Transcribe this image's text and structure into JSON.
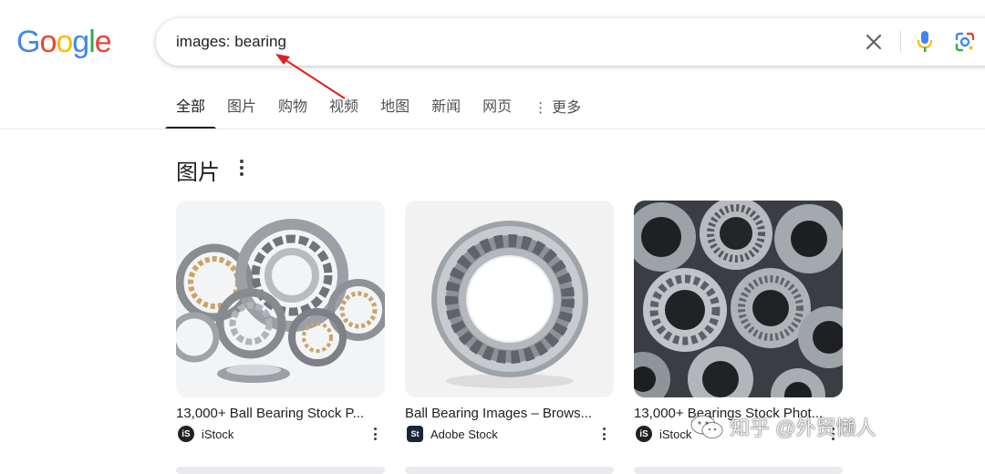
{
  "logo": {
    "letters": [
      {
        "ch": "G",
        "color": "#4285F4"
      },
      {
        "ch": "o",
        "color": "#EA4335"
      },
      {
        "ch": "o",
        "color": "#FBBC05"
      },
      {
        "ch": "g",
        "color": "#4285F4"
      },
      {
        "ch": "l",
        "color": "#34A853"
      },
      {
        "ch": "e",
        "color": "#EA4335"
      }
    ]
  },
  "search": {
    "query": "images: bearing"
  },
  "tabs": [
    {
      "label": "全部"
    },
    {
      "label": "图片"
    },
    {
      "label": "购物"
    },
    {
      "label": "视频"
    },
    {
      "label": "地图"
    },
    {
      "label": "新闻"
    },
    {
      "label": "网页"
    },
    {
      "label": "更多"
    }
  ],
  "images_section": {
    "title": "图片",
    "results": [
      {
        "caption": "13,000+ Ball Bearing Stock P...",
        "source": "iStock",
        "favicon_text": "iS"
      },
      {
        "caption": "Ball Bearing Images – Brows...",
        "source": "Adobe Stock",
        "favicon_text": "St"
      },
      {
        "caption": "13,000+ Bearings Stock Phot...",
        "source": "iStock",
        "favicon_text": "iS"
      }
    ]
  },
  "watermark": {
    "text": "知乎 @外贸懒人"
  },
  "colors": {
    "arrow": "#e02020",
    "active_tab_underline": "#1f1f1f"
  }
}
